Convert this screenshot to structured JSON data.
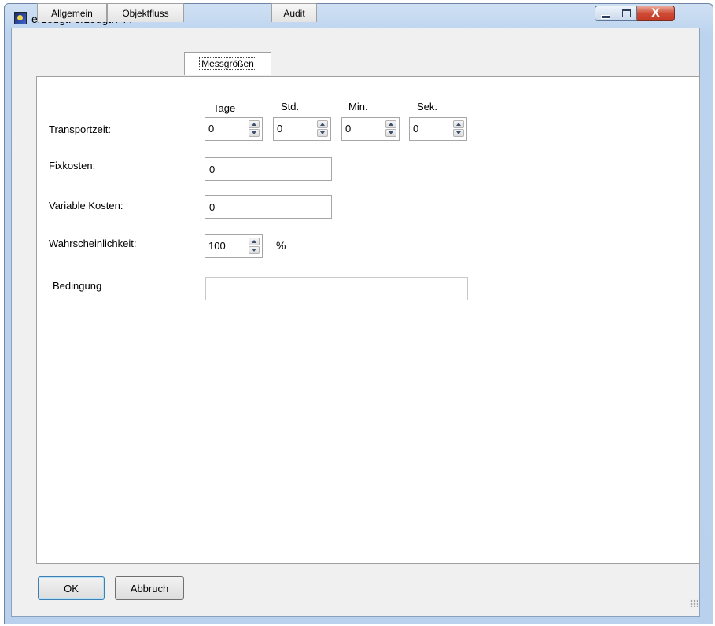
{
  "window": {
    "title": "erzeugt: erzeugt.744",
    "close_symbol": "X"
  },
  "tabs": [
    "Allgemein",
    "Objektfluss",
    "Messgrößen",
    "Audit"
  ],
  "active_tab": "Messgrößen",
  "form": {
    "transportzeit": {
      "label": "Transportzeit:",
      "units": [
        "Tage",
        "Std.",
        "Min.",
        "Sek."
      ],
      "values": [
        "0",
        "0",
        "0",
        "0"
      ]
    },
    "fixkosten": {
      "label": "Fixkosten:",
      "value": "0"
    },
    "variable_kosten": {
      "label": "Variable Kosten:",
      "value": "0"
    },
    "wahrscheinlichkeit": {
      "label": "Wahrscheinlichkeit:",
      "value": "100",
      "unit": "%"
    },
    "bedingung": {
      "label": "Bedingung",
      "value": ""
    }
  },
  "buttons": {
    "ok": "OK",
    "cancel": "Abbruch"
  }
}
